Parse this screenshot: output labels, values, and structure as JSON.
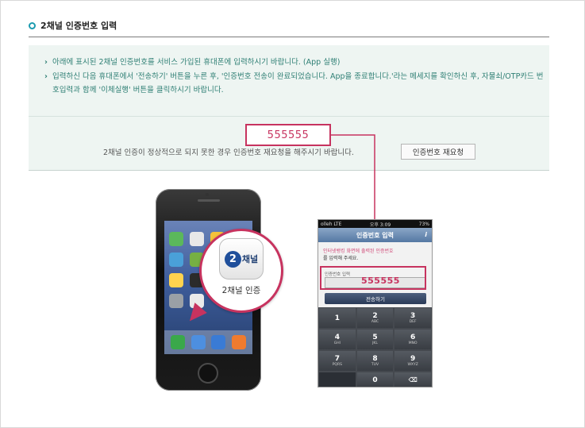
{
  "section": {
    "title": "2채널 인증번호 입력"
  },
  "notes": [
    "아래에 표시된 2채널 인증번호를 서비스 가입된 휴대폰에 입력하시기 바랍니다. (App 실행)",
    "입력하신 다음 휴대폰에서 '전송하기' 버튼을 누른 후, '인증번호 전송이 완료되었습니다. App을 종료합니다.'라는 메세지를 확인하신 후, 자물쇠/OTP카드 번호입력과 함께 '이체실행' 버튼을 클릭하시기 바랍니다."
  ],
  "auth_code": "555555",
  "reissue": {
    "message": "2채널 인증이 정상적으로 되지 못한 경우 인증번호 재요청을 해주시기 바랍니다.",
    "button_label": "인증번호 재요청"
  },
  "phone_illustration": {
    "app_icon_number": "2",
    "app_icon_word": "채널",
    "app_label": "2채널 인증"
  },
  "phone_screen": {
    "status_left": "olleh  LTE",
    "status_time": "오후 3:09",
    "status_right": "73%",
    "title": "인증번호 입력",
    "info_icon": "i",
    "desc_line1": "인터넷뱅킹 화면에 출력된 인증번호",
    "desc_line2": "를 입력해 주세요.",
    "field_label": "인증번호 입력",
    "code": "555555",
    "send_button": "전송하기",
    "keypad": [
      {
        "digit": "1",
        "letters": ""
      },
      {
        "digit": "2",
        "letters": "ABC"
      },
      {
        "digit": "3",
        "letters": "DEF"
      },
      {
        "digit": "4",
        "letters": "GHI"
      },
      {
        "digit": "5",
        "letters": "JKL"
      },
      {
        "digit": "6",
        "letters": "MNO"
      },
      {
        "digit": "7",
        "letters": "PQRS"
      },
      {
        "digit": "8",
        "letters": "TUV"
      },
      {
        "digit": "9",
        "letters": "WXYZ"
      },
      {
        "digit": "",
        "letters": ""
      },
      {
        "digit": "0",
        "letters": ""
      },
      {
        "digit": "⌫",
        "letters": ""
      }
    ]
  },
  "colors": {
    "accent": "#c7335f",
    "teal_text": "#2e7f74",
    "info_bg": "#eef5f2",
    "bullet": "#1c9bb0"
  },
  "icons": [
    "circle-bullet-icon",
    "chevron-right-icon",
    "app-2channel-icon",
    "backspace-icon",
    "info-icon"
  ]
}
